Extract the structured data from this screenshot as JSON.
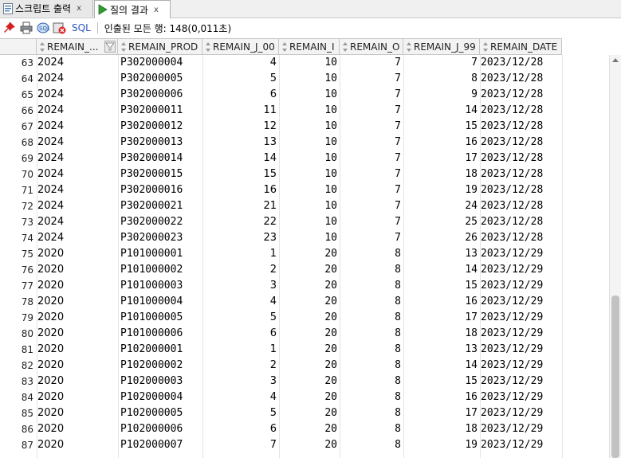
{
  "tabs": [
    {
      "label": "스크립트 출력",
      "close": "x"
    },
    {
      "label": "질의 결과",
      "close": "x"
    }
  ],
  "toolbar": {
    "sql_label": "SQL",
    "status_text": "인출된 모든 행: 148(0,011초)"
  },
  "columns": [
    "REMAIN_...",
    "REMAIN_PROD",
    "REMAIN_J_00",
    "REMAIN_I",
    "REMAIN_O",
    "REMAIN_J_99",
    "REMAIN_DATE"
  ],
  "rows": [
    {
      "n": "63",
      "year": "2024",
      "prod": "P302000004",
      "j00": "4",
      "i": "10",
      "o": "7",
      "j99": "7",
      "date": "2023/12/28"
    },
    {
      "n": "64",
      "year": "2024",
      "prod": "P302000005",
      "j00": "5",
      "i": "10",
      "o": "7",
      "j99": "8",
      "date": "2023/12/28"
    },
    {
      "n": "65",
      "year": "2024",
      "prod": "P302000006",
      "j00": "6",
      "i": "10",
      "o": "7",
      "j99": "9",
      "date": "2023/12/28"
    },
    {
      "n": "66",
      "year": "2024",
      "prod": "P302000011",
      "j00": "11",
      "i": "10",
      "o": "7",
      "j99": "14",
      "date": "2023/12/28"
    },
    {
      "n": "67",
      "year": "2024",
      "prod": "P302000012",
      "j00": "12",
      "i": "10",
      "o": "7",
      "j99": "15",
      "date": "2023/12/28"
    },
    {
      "n": "68",
      "year": "2024",
      "prod": "P302000013",
      "j00": "13",
      "i": "10",
      "o": "7",
      "j99": "16",
      "date": "2023/12/28"
    },
    {
      "n": "69",
      "year": "2024",
      "prod": "P302000014",
      "j00": "14",
      "i": "10",
      "o": "7",
      "j99": "17",
      "date": "2023/12/28"
    },
    {
      "n": "70",
      "year": "2024",
      "prod": "P302000015",
      "j00": "15",
      "i": "10",
      "o": "7",
      "j99": "18",
      "date": "2023/12/28"
    },
    {
      "n": "71",
      "year": "2024",
      "prod": "P302000016",
      "j00": "16",
      "i": "10",
      "o": "7",
      "j99": "19",
      "date": "2023/12/28"
    },
    {
      "n": "72",
      "year": "2024",
      "prod": "P302000021",
      "j00": "21",
      "i": "10",
      "o": "7",
      "j99": "24",
      "date": "2023/12/28"
    },
    {
      "n": "73",
      "year": "2024",
      "prod": "P302000022",
      "j00": "22",
      "i": "10",
      "o": "7",
      "j99": "25",
      "date": "2023/12/28"
    },
    {
      "n": "74",
      "year": "2024",
      "prod": "P302000023",
      "j00": "23",
      "i": "10",
      "o": "7",
      "j99": "26",
      "date": "2023/12/28"
    },
    {
      "n": "75",
      "year": "2020",
      "prod": "P101000001",
      "j00": "1",
      "i": "20",
      "o": "8",
      "j99": "13",
      "date": "2023/12/29"
    },
    {
      "n": "76",
      "year": "2020",
      "prod": "P101000002",
      "j00": "2",
      "i": "20",
      "o": "8",
      "j99": "14",
      "date": "2023/12/29"
    },
    {
      "n": "77",
      "year": "2020",
      "prod": "P101000003",
      "j00": "3",
      "i": "20",
      "o": "8",
      "j99": "15",
      "date": "2023/12/29"
    },
    {
      "n": "78",
      "year": "2020",
      "prod": "P101000004",
      "j00": "4",
      "i": "20",
      "o": "8",
      "j99": "16",
      "date": "2023/12/29"
    },
    {
      "n": "79",
      "year": "2020",
      "prod": "P101000005",
      "j00": "5",
      "i": "20",
      "o": "8",
      "j99": "17",
      "date": "2023/12/29"
    },
    {
      "n": "80",
      "year": "2020",
      "prod": "P101000006",
      "j00": "6",
      "i": "20",
      "o": "8",
      "j99": "18",
      "date": "2023/12/29"
    },
    {
      "n": "81",
      "year": "2020",
      "prod": "P102000001",
      "j00": "1",
      "i": "20",
      "o": "8",
      "j99": "13",
      "date": "2023/12/29"
    },
    {
      "n": "82",
      "year": "2020",
      "prod": "P102000002",
      "j00": "2",
      "i": "20",
      "o": "8",
      "j99": "14",
      "date": "2023/12/29"
    },
    {
      "n": "83",
      "year": "2020",
      "prod": "P102000003",
      "j00": "3",
      "i": "20",
      "o": "8",
      "j99": "15",
      "date": "2023/12/29"
    },
    {
      "n": "84",
      "year": "2020",
      "prod": "P102000004",
      "j00": "4",
      "i": "20",
      "o": "8",
      "j99": "16",
      "date": "2023/12/29"
    },
    {
      "n": "85",
      "year": "2020",
      "prod": "P102000005",
      "j00": "5",
      "i": "20",
      "o": "8",
      "j99": "17",
      "date": "2023/12/29"
    },
    {
      "n": "86",
      "year": "2020",
      "prod": "P102000006",
      "j00": "6",
      "i": "20",
      "o": "8",
      "j99": "18",
      "date": "2023/12/29"
    },
    {
      "n": "87",
      "year": "2020",
      "prod": "P102000007",
      "j00": "7",
      "i": "20",
      "o": "8",
      "j99": "19",
      "date": "2023/12/29"
    }
  ]
}
